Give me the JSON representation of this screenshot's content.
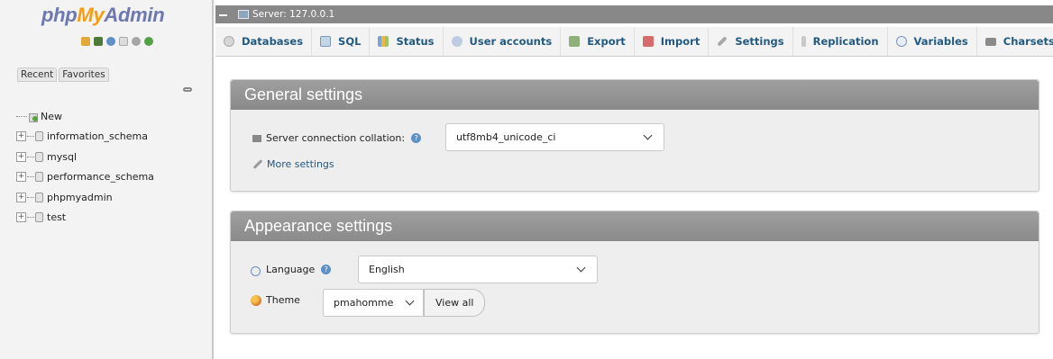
{
  "nav": {
    "logo": {
      "php": "php",
      "my": "My",
      "admin": "Admin"
    },
    "tabs": [
      "Recent",
      "Favorites"
    ],
    "tree": [
      {
        "label": "New",
        "type": "new"
      },
      {
        "label": "information_schema",
        "type": "db"
      },
      {
        "label": "mysql",
        "type": "db"
      },
      {
        "label": "performance_schema",
        "type": "db"
      },
      {
        "label": "phpmyadmin",
        "type": "db"
      },
      {
        "label": "test",
        "type": "db"
      }
    ]
  },
  "topbar": {
    "server_label": "Server: 127.0.0.1"
  },
  "menu": {
    "items": [
      {
        "label": "Databases",
        "icon": "database-icon"
      },
      {
        "label": "SQL",
        "icon": "sql-icon"
      },
      {
        "label": "Status",
        "icon": "status-icon"
      },
      {
        "label": "User accounts",
        "icon": "users-icon"
      },
      {
        "label": "Export",
        "icon": "export-icon"
      },
      {
        "label": "Import",
        "icon": "import-icon"
      },
      {
        "label": "Settings",
        "icon": "settings-icon"
      },
      {
        "label": "Replication",
        "icon": "replication-icon"
      },
      {
        "label": "Variables",
        "icon": "variables-icon"
      },
      {
        "label": "Charsets",
        "icon": "charsets-icon"
      }
    ]
  },
  "general_settings": {
    "title": "General settings",
    "collation_label": "Server connection collation:",
    "collation_value": "utf8mb4_unicode_ci",
    "more_settings": "More settings"
  },
  "appearance_settings": {
    "title": "Appearance settings",
    "language_label": "Language",
    "language_value": "English",
    "theme_label": "Theme",
    "theme_value": "pmahomme",
    "view_all": "View all"
  },
  "colors": {
    "logo_blue": "#6c78af",
    "logo_orange": "#f89c0e",
    "link_blue": "#235a81",
    "panel_header": "#8f8f8f"
  }
}
